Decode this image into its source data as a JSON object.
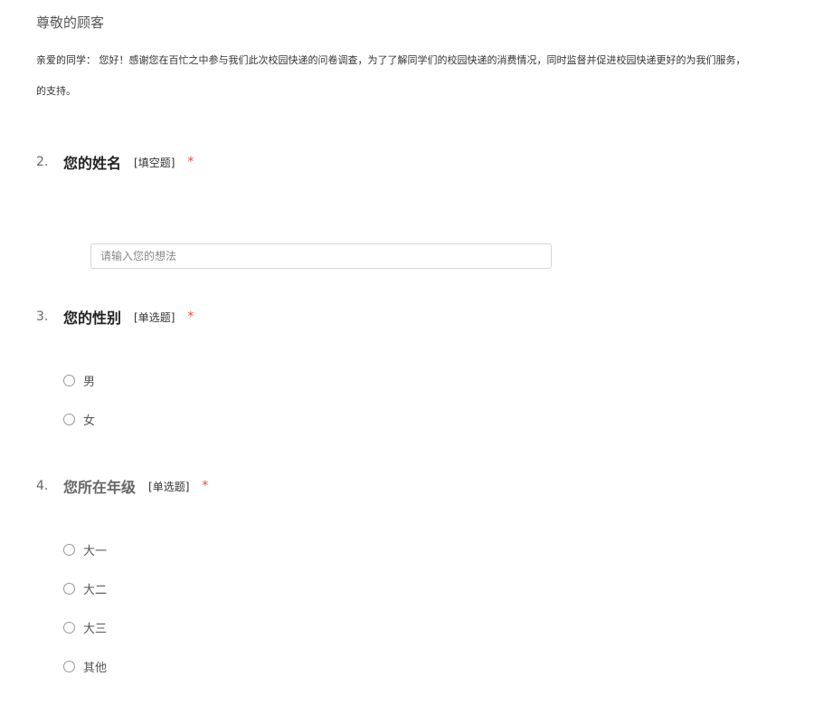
{
  "greeting": {
    "title": "尊敬的顾客",
    "intro_line_1": "亲爱的同学：  您好！感谢您在百忙之中参与我们此次校园快递的问卷调查，为了了解同学们的校园快递的消费情况，同时监督并促进校园快递更好的为我们服务，",
    "intro_line_2": "的支持。"
  },
  "questions": [
    {
      "number": "2.",
      "title": "您的姓名",
      "type": "[填空题]",
      "required": "*",
      "input": {
        "placeholder": "请输入您的想法",
        "value": ""
      }
    },
    {
      "number": "3.",
      "title": "您的性别",
      "type": "[单选题]",
      "required": "*",
      "options": [
        "男",
        "女"
      ]
    },
    {
      "number": "4.",
      "title": "您所在年级",
      "type": "[单选题]",
      "required": "*",
      "options": [
        "大一",
        "大二",
        "大三",
        "其他"
      ]
    }
  ],
  "colors": {
    "required_star": "#e74c3c",
    "input_border": "#d5d5d5",
    "radio_border": "#999999"
  }
}
